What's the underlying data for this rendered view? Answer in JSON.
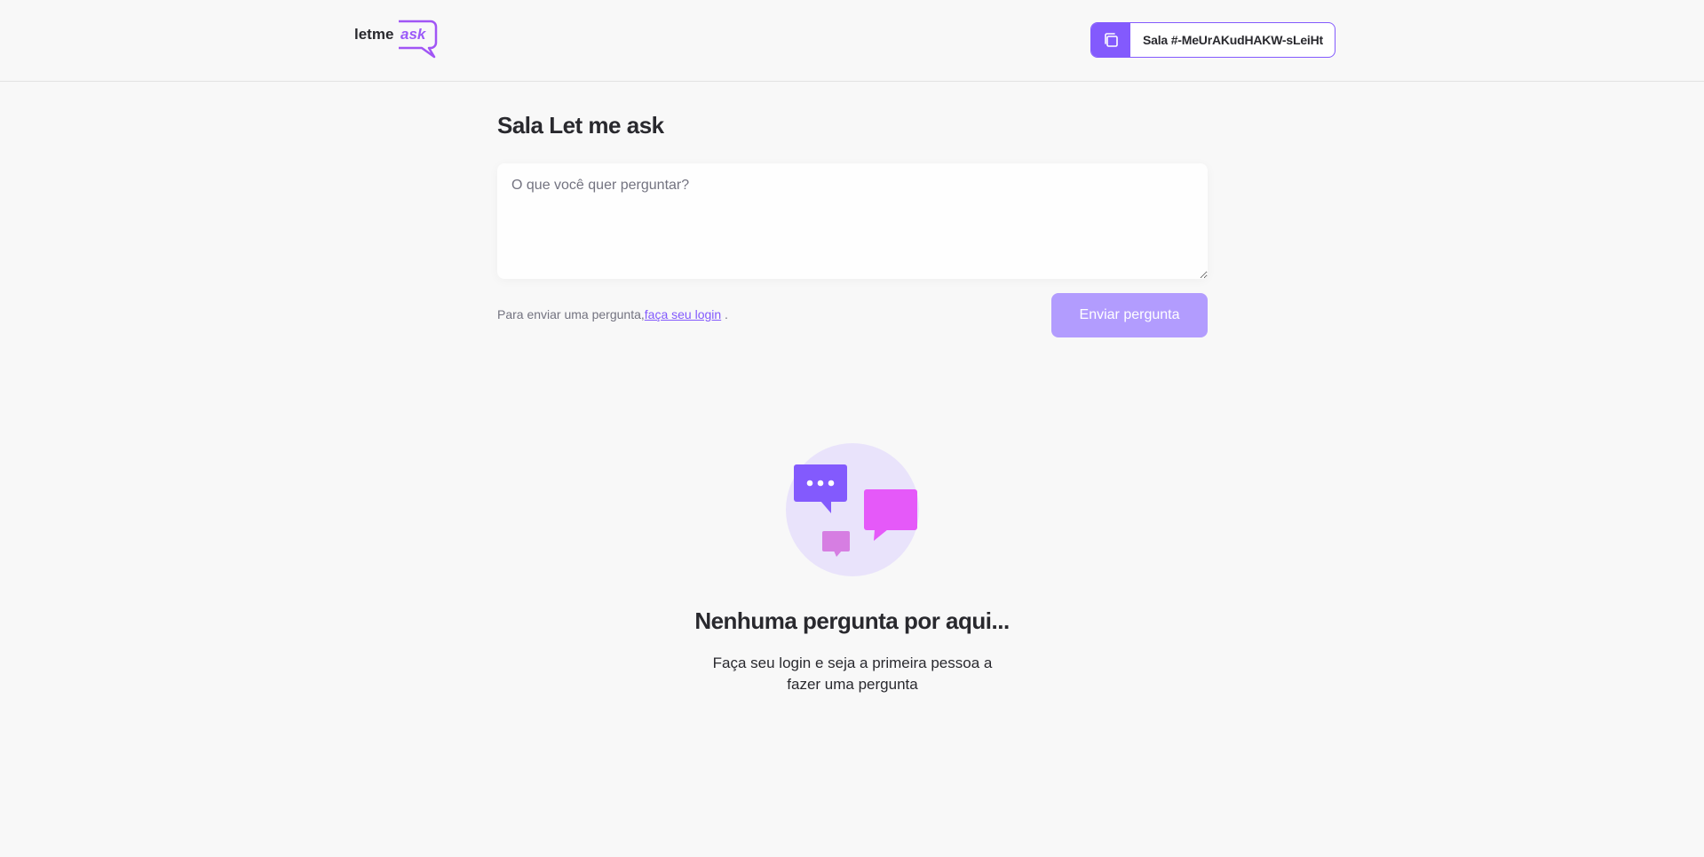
{
  "header": {
    "logo": {
      "text_main": "letme",
      "text_accent": "ask"
    },
    "room_code": {
      "label": "Sala #-MeUrAKudHAKW-sLeiHt",
      "icon": "copy-icon"
    }
  },
  "main": {
    "title": "Sala Let me ask",
    "question_input": {
      "placeholder": "O que você quer perguntar?",
      "value": ""
    },
    "login_hint": {
      "prefix": "Para enviar uma pergunta,",
      "link": "faça seu login",
      "suffix": " ."
    },
    "send_button_label": "Enviar pergunta"
  },
  "empty_state": {
    "title": "Nenhuma pergunta por aqui...",
    "subtitle": "Faça seu login e seja a primeira pessoa a fazer uma pergunta",
    "icon": "empty-questions-illustration"
  },
  "colors": {
    "brand": "#835afd",
    "brand_disabled": "#b29cfe",
    "accent_pink": "#e559f9",
    "background": "#f8f8f8"
  }
}
